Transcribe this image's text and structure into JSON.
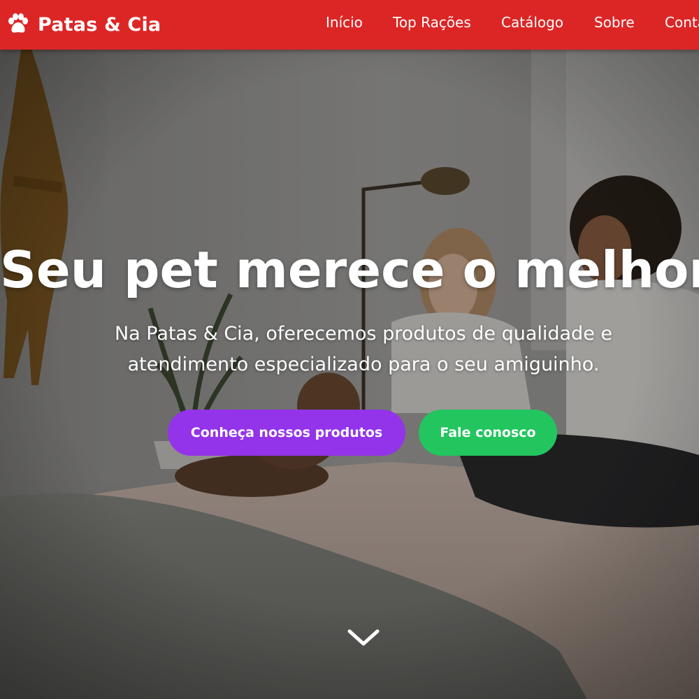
{
  "brand": {
    "name": "Patas & Cia",
    "logo_icon": "paw-icon"
  },
  "nav": {
    "items": [
      {
        "label": "Início"
      },
      {
        "label": "Top Rações"
      },
      {
        "label": "Catálogo"
      },
      {
        "label": "Sobre"
      },
      {
        "label": "Contato"
      }
    ]
  },
  "hero": {
    "title": "Seu pet merece o melhor",
    "subtitle": "Na Patas & Cia, oferecemos produtos de qualidade e atendimento especializado para o seu amiguinho.",
    "primary_button": "Conheça nossos produtos",
    "secondary_button": "Fale conosco",
    "scroll_icon": "chevron-down-icon"
  },
  "colors": {
    "navbar": "#dc2626",
    "primary_button": "#9333ea",
    "secondary_button": "#22c55e"
  }
}
